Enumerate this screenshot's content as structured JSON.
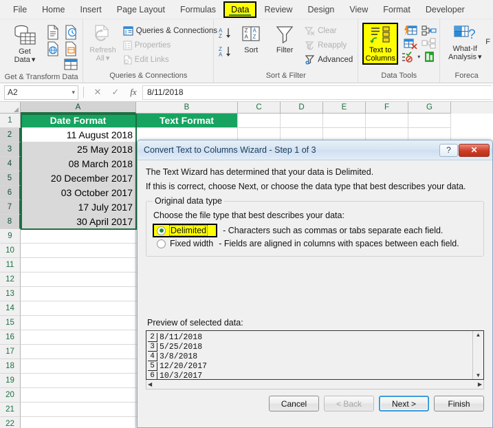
{
  "ribbon": {
    "tabs": [
      {
        "label": "File",
        "active": false
      },
      {
        "label": "Home",
        "active": false
      },
      {
        "label": "Insert",
        "active": false
      },
      {
        "label": "Page Layout",
        "active": false
      },
      {
        "label": "Formulas",
        "active": false
      },
      {
        "label": "Data",
        "active": true
      },
      {
        "label": "Review",
        "active": false
      },
      {
        "label": "Design",
        "active": false
      },
      {
        "label": "View",
        "active": false
      },
      {
        "label": "Format",
        "active": false
      },
      {
        "label": "Developer",
        "active": false
      }
    ],
    "groups": {
      "get_transform": {
        "title": "Get & Transform Data",
        "get_data_line1": "Get",
        "get_data_line2": "Data",
        "get_data_caret": "▾"
      },
      "queries": {
        "title": "Queries & Connections",
        "refresh_line1": "Refresh",
        "refresh_line2": "All",
        "refresh_caret": "▾",
        "items": [
          {
            "label": "Queries & Connections",
            "disabled": false
          },
          {
            "label": "Properties",
            "disabled": true
          },
          {
            "label": "Edit Links",
            "disabled": true
          }
        ]
      },
      "sort_filter": {
        "title": "Sort & Filter",
        "sort_label": "Sort",
        "filter_label": "Filter",
        "az_top": "A",
        "az_bottom": "Z",
        "za_top": "Z",
        "za_bottom": "A",
        "items": [
          {
            "label": "Clear",
            "disabled": true
          },
          {
            "label": "Reapply",
            "disabled": true
          },
          {
            "label": "Advanced",
            "disabled": false
          }
        ]
      },
      "data_tools": {
        "title": "Data Tools",
        "text_to_columns_line1": "Text to",
        "text_to_columns_line2": "Columns",
        "dropdown_caret": "▾"
      },
      "forecast": {
        "title": "Foreca",
        "what_if_line1": "What-If",
        "what_if_line2": "Analysis",
        "what_if_caret": "▾",
        "truncated_label": "F"
      }
    }
  },
  "formula_bar": {
    "name_box_value": "A2",
    "name_box_caret": "▾",
    "cancel_icon": "✕",
    "confirm_icon": "✓",
    "function_icon": "fx",
    "formula_value": "8/11/2018"
  },
  "grid": {
    "columns": [
      "A",
      "B",
      "C",
      "D",
      "E",
      "F",
      "G"
    ],
    "selected_column": "A",
    "rows": [
      "1",
      "2",
      "3",
      "4",
      "5",
      "6",
      "7",
      "8",
      "9",
      "10",
      "11",
      "12",
      "13",
      "14",
      "15",
      "16",
      "17",
      "18",
      "19",
      "20",
      "21",
      "22"
    ],
    "selected_rows": [
      "2",
      "3",
      "4",
      "5",
      "6",
      "7",
      "8"
    ],
    "active_cell": "A2",
    "header_color": "#17a360",
    "selection_color": "#1d6f42",
    "col_a": {
      "header": "Date Format",
      "values": [
        "11 August 2018",
        "25 May 2018",
        "08 March 2018",
        "20 December 2017",
        "03 October 2017",
        "17 July 2017",
        "30 April 2017"
      ]
    },
    "col_b": {
      "header": "Text Format"
    }
  },
  "dialog": {
    "title": "Convert Text to Columns Wizard - Step 1 of 3",
    "help_icon": "?",
    "close_icon": "✕",
    "line1": "The Text Wizard has determined that your data is Delimited.",
    "line2": "If this is correct, choose Next, or choose the data type that best describes your data.",
    "group_legend": "Original data type",
    "group_subtext": "Choose the file type that best describes your data:",
    "options": [
      {
        "label": "Delimited",
        "description": "- Characters such as commas or tabs separate each field.",
        "selected": true,
        "highlighted": true
      },
      {
        "label": "Fixed width",
        "description": "- Fields are aligned in columns with spaces between each field.",
        "selected": false,
        "highlighted": false
      }
    ],
    "preview_label": "Preview of selected data:",
    "preview_rows": [
      {
        "num": "2",
        "text": "8/11/2018"
      },
      {
        "num": "3",
        "text": "5/25/2018"
      },
      {
        "num": "4",
        "text": "3/8/2018"
      },
      {
        "num": "5",
        "text": "12/20/2017"
      },
      {
        "num": "6",
        "text": "10/3/2017"
      }
    ],
    "scroll_up_icon": "▲",
    "scroll_down_icon": "▼",
    "scroll_left_icon": "◀",
    "scroll_right_icon": "▶",
    "buttons": [
      {
        "label": "Cancel",
        "state": "normal"
      },
      {
        "label": "< Back",
        "state": "disabled"
      },
      {
        "label": "Next >",
        "state": "default"
      },
      {
        "label": "Finish",
        "state": "normal"
      }
    ],
    "highlight_color": "#ffff00"
  }
}
